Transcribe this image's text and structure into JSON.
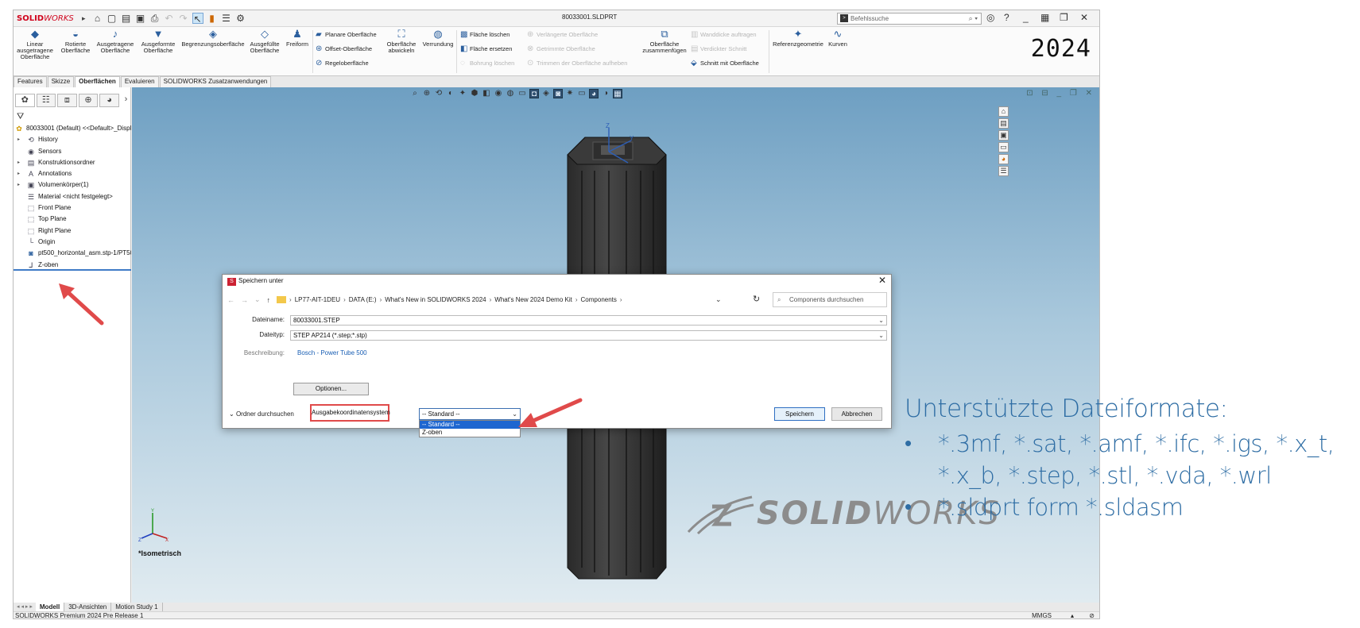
{
  "app": {
    "logo_brand": "SOLID",
    "logo_suffix": "WORKS",
    "document_title": "80033001.SLDPRT",
    "command_search_placeholder": "Befehlssuche",
    "year": "2024"
  },
  "ribbon": {
    "big_buttons": [
      {
        "label": "Linear ausgetragene Oberfläche",
        "icon": "extrude-surface-icon"
      },
      {
        "label": "Rotierte Oberfläche",
        "icon": "revolve-surface-icon"
      },
      {
        "label": "Ausgetragene Oberfläche",
        "icon": "sweep-surface-icon"
      },
      {
        "label": "Ausgeformte Oberfläche",
        "icon": "loft-surface-icon"
      },
      {
        "label": "Begrenzungsoberfläche",
        "icon": "boundary-surface-icon"
      },
      {
        "label": "Ausgefüllte Oberfläche",
        "icon": "filled-surface-icon"
      },
      {
        "label": "Freiform",
        "icon": "freeform-icon"
      }
    ],
    "col1": [
      "Planare Oberfläche",
      "Offset-Oberfläche",
      "Regeloberfläche"
    ],
    "mid_buttons": [
      {
        "label": "Oberfläche abwickeln",
        "icon": "flatten-surface-icon"
      },
      {
        "label": "Verrundung",
        "icon": "fillet-icon"
      }
    ],
    "col2": [
      "Fläche löschen",
      "Fläche ersetzen",
      "Bohrung löschen"
    ],
    "col3": [
      "Verlängerte Oberfläche",
      "Getrimmte Oberfläche",
      "Trimmen der Oberfläche aufheben"
    ],
    "knit_button": "Oberfläche zusammenfügen",
    "col4": [
      "Wanddicke auftragen",
      "Verdickter Schnitt",
      "Schnitt mit Oberfläche"
    ],
    "right_buttons": [
      "Referenzgeometrie",
      "Kurven"
    ]
  },
  "tabs": [
    "Features",
    "Skizze",
    "Oberflächen",
    "Evaluieren",
    "SOLIDWORKS Zusatzanwendungen"
  ],
  "active_tab_index": 2,
  "tree": {
    "root": "80033001 (Default) <<Default>_Displa",
    "nodes": [
      {
        "label": "History",
        "icon": "history-icon",
        "expandable": true
      },
      {
        "label": "Sensors",
        "icon": "sensor-icon",
        "expandable": false
      },
      {
        "label": "Konstruktionsordner",
        "icon": "folder-icon",
        "expandable": true
      },
      {
        "label": "Annotations",
        "icon": "annotation-icon",
        "expandable": true
      },
      {
        "label": "Volumenkörper(1)",
        "icon": "solid-body-icon",
        "expandable": true
      },
      {
        "label": "Material <nicht festgelegt>",
        "icon": "material-icon",
        "expandable": false
      },
      {
        "label": "Front Plane",
        "icon": "plane-icon",
        "expandable": false
      },
      {
        "label": "Top Plane",
        "icon": "plane-icon",
        "expandable": false
      },
      {
        "label": "Right Plane",
        "icon": "plane-icon",
        "expandable": false
      },
      {
        "label": "Origin",
        "icon": "origin-icon",
        "expandable": false
      },
      {
        "label": "pt500_horizontal_asm.stp-1/PT50(",
        "icon": "imported-part-icon",
        "expandable": false
      },
      {
        "label": "Z-oben",
        "icon": "coordinate-system-icon",
        "expandable": false
      }
    ]
  },
  "viewport": {
    "view_name": "*Isometrisch",
    "watermark_brand": "SOLID",
    "watermark_suffix": "WORKS"
  },
  "bottom_tabs": [
    "Modell",
    "3D-Ansichten",
    "Motion Study 1"
  ],
  "status": {
    "left": "SOLIDWORKS Premium 2024 Pre Release 1",
    "units": "MMGS"
  },
  "dialog": {
    "title": "Speichern unter",
    "breadcrumbs": [
      "LP77-AIT-1DEU",
      "DATA (E:)",
      "What's New in SOLIDWORKS 2024",
      "What's New 2024 Demo Kit",
      "Components"
    ],
    "search_placeholder": "Components durchsuchen",
    "filename_label": "Dateiname:",
    "filename_value": "80033001.STEP",
    "filetype_label": "Dateityp:",
    "filetype_value": "STEP AP214 (*.step;*.stp)",
    "description_label": "Beschreibung:",
    "description_value": "Bosch - Power Tube 500",
    "options_button": "Optionen...",
    "browse_toggle": "Ordner durchsuchen",
    "coord_label": "Ausgabekoordinatensystem",
    "coord_selected": "-- Standard --",
    "coord_options": [
      "-- Standard --",
      "Z-oben"
    ],
    "save_button": "Speichern",
    "cancel_button": "Abbrechen"
  },
  "slide": {
    "heading": "Unterstützte Dateiformate:",
    "bullets": [
      "*.3mf, *.sat, *.amf, *.ifc, *.igs, *.x_t, *.x_b, *.step, *.stl, *.vda, *.wrl",
      "*.sldprt form *.sldasm"
    ]
  },
  "colors": {
    "accent_red": "#e04a4a",
    "slide_blue": "#2e6da4",
    "solidworks_red": "#d0021b"
  }
}
